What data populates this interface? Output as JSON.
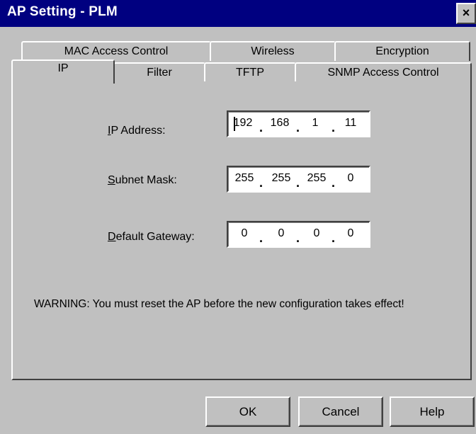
{
  "window": {
    "title": "AP Setting - PLM",
    "close_glyph": "×"
  },
  "tabs": {
    "back_row": [
      "MAC Access Control",
      "Wireless",
      "Encryption"
    ],
    "front_row": [
      "IP",
      "Filter",
      "TFTP",
      "SNMP Access Control"
    ],
    "active": "IP"
  },
  "fields": {
    "ip_address": {
      "mnemonic": "I",
      "rest": "P Address:",
      "octets": [
        "192",
        "168",
        "1",
        "11"
      ]
    },
    "subnet_mask": {
      "mnemonic": "S",
      "rest": "ubnet Mask:",
      "octets": [
        "255",
        "255",
        "255",
        "0"
      ]
    },
    "default_gateway": {
      "mnemonic": "D",
      "rest": "efault Gateway:",
      "octets": [
        "0",
        "0",
        "0",
        "0"
      ]
    }
  },
  "warning": "WARNING: You must reset the AP before the new configuration takes effect!",
  "buttons": {
    "ok": "OK",
    "cancel": "Cancel",
    "help": "Help"
  },
  "colors": {
    "titlebar": "#000080",
    "face": "#c0c0c0"
  }
}
